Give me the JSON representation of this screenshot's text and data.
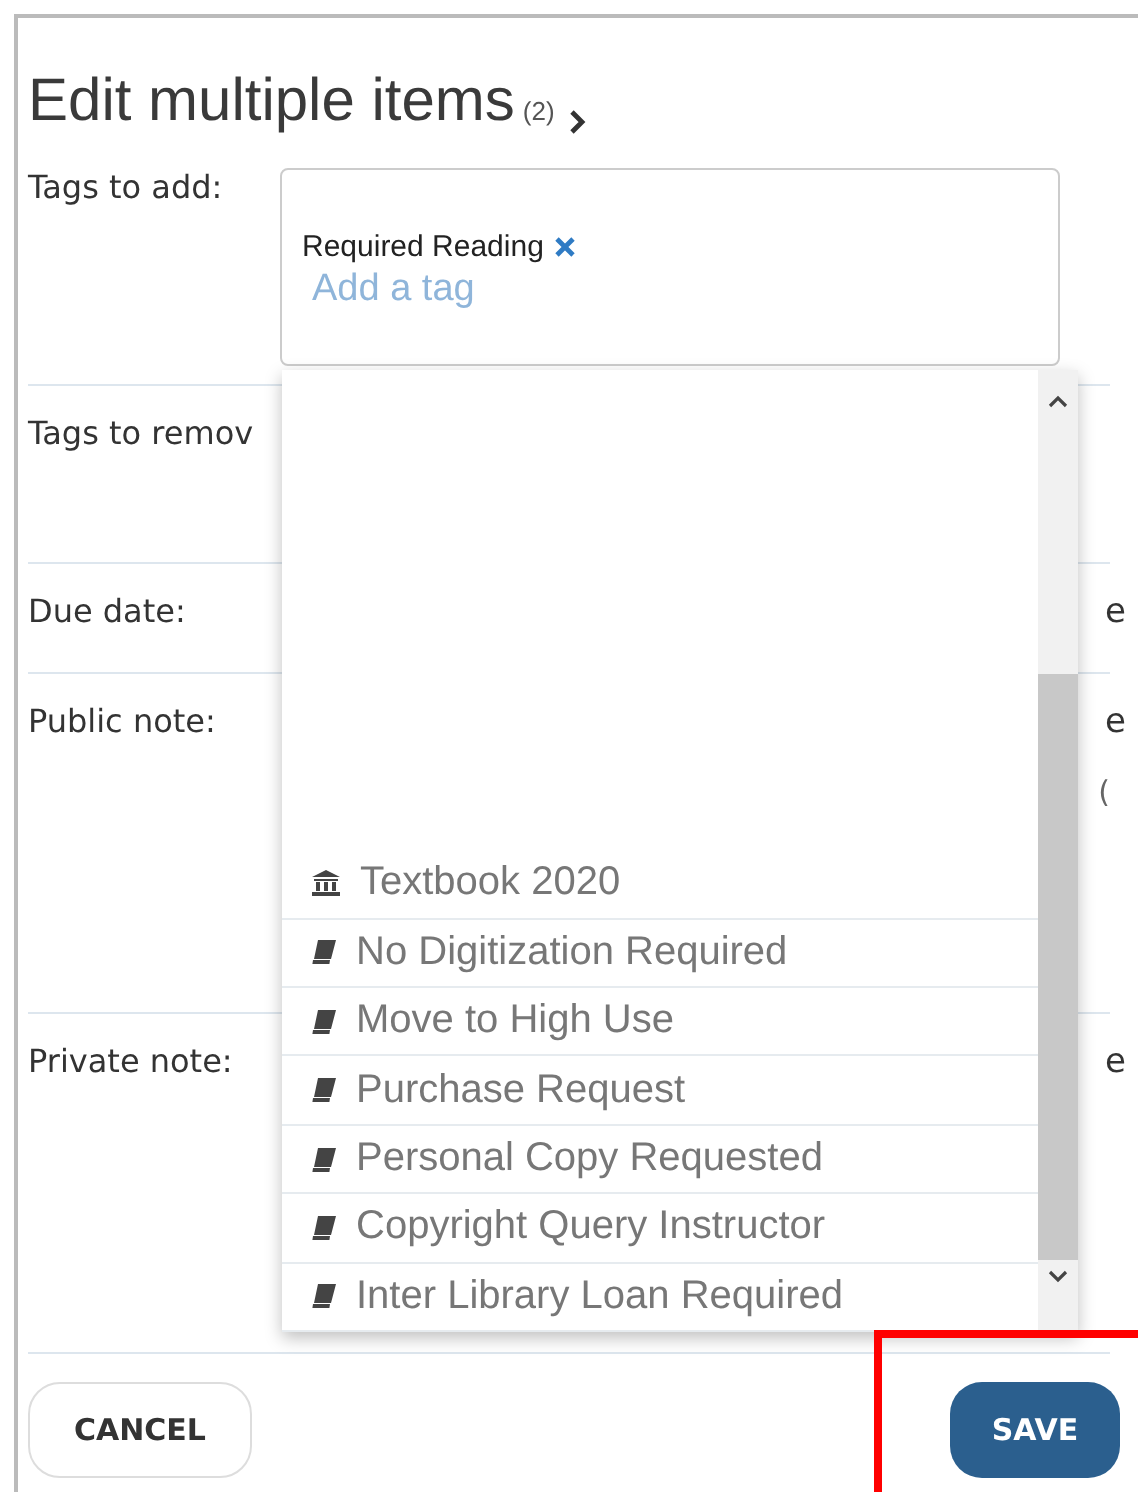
{
  "title": "Edit multiple items",
  "count": "(2)",
  "tags_to_add": {
    "label": "Tags to add:",
    "tags": [
      "Required Reading"
    ],
    "placeholder": "Add a tag"
  },
  "fields": [
    {
      "label": "Tags to remov"
    },
    {
      "label": "Due date:",
      "trailing": [
        "e"
      ]
    },
    {
      "label": "Public note:",
      "trailing": [
        "e",
        "("
      ]
    },
    {
      "label": "Private note:",
      "trailing": [
        "e"
      ]
    }
  ],
  "dropdown": {
    "items": [
      {
        "text": "Textbook 2020",
        "kind": "institution"
      },
      {
        "text": "No Digitization Required",
        "kind": "book"
      },
      {
        "text": "Move to High Use",
        "kind": "book"
      },
      {
        "text": "Purchase Request",
        "kind": "book"
      },
      {
        "text": "Personal Copy Requested",
        "kind": "book"
      },
      {
        "text": "Copyright Query Instructor",
        "kind": "book"
      },
      {
        "text": "Inter Library Loan Required",
        "kind": "book"
      }
    ]
  },
  "buttons": [
    {
      "label": "CANCEL",
      "kind": "secondary"
    },
    {
      "label": "SAVE",
      "kind": "primary",
      "highlighted": true
    }
  ]
}
